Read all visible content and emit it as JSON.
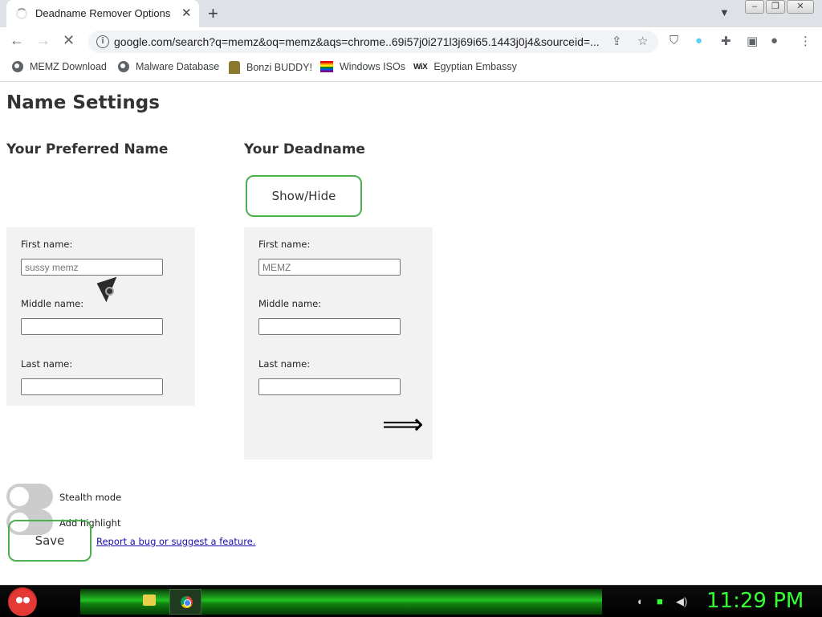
{
  "browser": {
    "tab_title": "Deadname Remover Options",
    "tab_close": "✕",
    "new_tab": "+",
    "url": "google.com/search?q=memz&oq=memz&aqs=chrome..69i57j0i271l3j69i65.1443j0j4&sourceid=...",
    "bookmarks": [
      {
        "label": "MEMZ Download",
        "icon": "globe-icon"
      },
      {
        "label": "Malware Database",
        "icon": "globe-icon"
      },
      {
        "label": "Bonzi BUDDY!",
        "icon": "bonzi-icon"
      },
      {
        "label": "Windows ISOs",
        "icon": "rainbow-flag-icon"
      },
      {
        "label": "Egyptian Embassy",
        "icon": "wix-icon",
        "icon_text": "WiX"
      }
    ]
  },
  "page": {
    "title": "Name Settings",
    "preferred": {
      "heading": "Your Preferred Name",
      "first_label": "First name:",
      "first_placeholder": "sussy memz",
      "middle_label": "Middle name:",
      "last_label": "Last name:"
    },
    "deadname": {
      "heading": "Your Deadname",
      "show_hide": "Show/Hide",
      "first_label": "First name:",
      "first_placeholder": "MEMZ",
      "middle_label": "Middle name:",
      "last_label": "Last name:",
      "arrow": "⟹"
    },
    "toggles": {
      "stealth_label": "Stealth mode",
      "highlight_label": "Add highlight"
    },
    "save_label": "Save",
    "report_link": "Report a bug or suggest a feature."
  },
  "taskbar": {
    "clock": "11:29 PM"
  }
}
